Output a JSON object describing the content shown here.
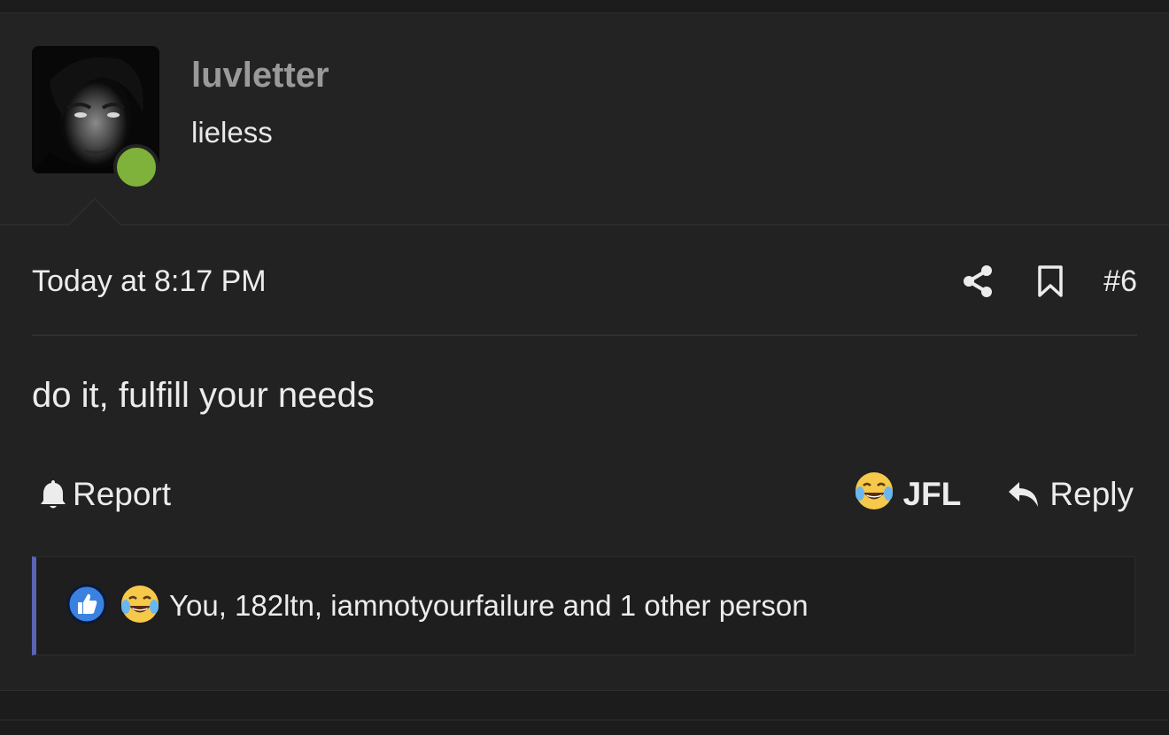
{
  "user": {
    "username": "luvletter",
    "title": "lieless",
    "online": true
  },
  "post": {
    "timestamp": "Today at 8:17 PM",
    "number": "#6",
    "message": "do it, fulfill your needs"
  },
  "actions": {
    "report_label": "Report",
    "reaction_label": "JFL",
    "reply_label": "Reply"
  },
  "reactions": {
    "summary": "You, 182ltn, iamnotyourfailure and 1 other person"
  },
  "colors": {
    "online": "#7fb23a",
    "accent_bar": "#5a64b4",
    "username": "#9a9a9a",
    "like_icon": "#3b82e0"
  },
  "icons": {
    "share": "share-icon",
    "bookmark": "bookmark-icon",
    "report": "bell-icon",
    "reaction": "laughing-crying-emoji",
    "reply": "reply-arrow-icon",
    "like": "thumbs-up-icon"
  }
}
